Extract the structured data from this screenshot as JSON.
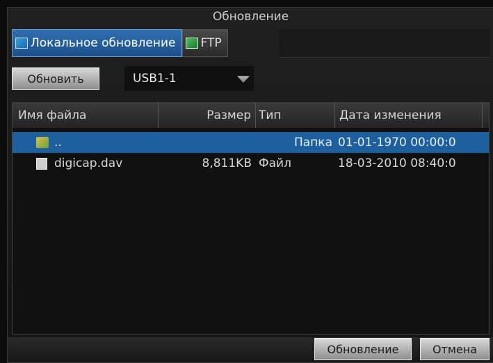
{
  "window": {
    "title": "Обновление"
  },
  "tabs": [
    {
      "label": "Локальное обновление",
      "icon": "local-update-icon"
    },
    {
      "label": "FTP",
      "icon": "ftp-icon"
    }
  ],
  "toolbar": {
    "refresh_label": "Обновить",
    "device_selected": "USB1-1"
  },
  "files": {
    "columns": [
      "Имя файла",
      "Размер",
      "Тип",
      "Дата изменения"
    ],
    "rows": [
      {
        "name": "..",
        "size": "",
        "type": "Папка",
        "modified": "01-01-1970 00:00:0",
        "icon": "folder-icon"
      },
      {
        "name": "digicap.dav",
        "size": "8,811KB",
        "type": "Файл",
        "modified": "18-03-2010 08:40:0",
        "icon": "file-icon"
      }
    ]
  },
  "footer": {
    "update_label": "Обновление",
    "cancel_label": "Отмена"
  },
  "colors": {
    "selection": "#1e5f9e",
    "active_tab": "#2f6fb0",
    "button": "#bdbdbd"
  }
}
